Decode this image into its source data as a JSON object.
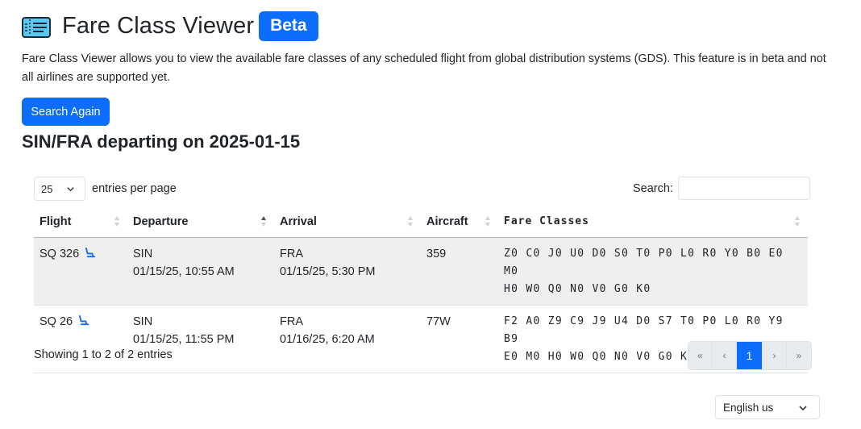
{
  "header": {
    "title": "Fare Class Viewer",
    "badge": "Beta",
    "description": "Fare Class Viewer allows you to view the available fare classes of any scheduled flight from global distribution systems (GDS). This feature is in beta and not all airlines are supported yet."
  },
  "search_again_label": "Search Again",
  "route_heading": "SIN/FRA departing on 2025-01-15",
  "controls": {
    "entries_value": "25",
    "entries_label": "entries per page",
    "search_label": "Search:",
    "search_value": ""
  },
  "table": {
    "columns": [
      "Flight",
      "Departure",
      "Arrival",
      "Aircraft",
      "Fare Classes"
    ],
    "rows": [
      {
        "flight": "SQ 326",
        "dep_airport": "SIN",
        "dep_time": "01/15/25, 10:55 AM",
        "arr_airport": "FRA",
        "arr_time": "01/15/25, 5:30 PM",
        "aircraft": "359",
        "fares_line1": "Z0 C0 J0 U0 D0 S0 T0 P0 L0 R0 Y0 B0 E0 M0",
        "fares_line2": "H0 W0 Q0 N0 V0 G0 K0"
      },
      {
        "flight": "SQ 26",
        "dep_airport": "SIN",
        "dep_time": "01/15/25, 11:55 PM",
        "arr_airport": "FRA",
        "arr_time": "01/16/25, 6:20 AM",
        "aircraft": "77W",
        "fares_line1": "F2 A0 Z9 C9 J9 U4 D0 S7 T0 P0 L0 R0 Y9 B9",
        "fares_line2": "E0 M0 H0 W0 Q0 N0 V0 G0 K0"
      }
    ]
  },
  "footer_info": "Showing 1 to 2 of 2 entries",
  "pagination": [
    "«",
    "‹",
    "1",
    "›",
    "»"
  ],
  "language": "English us",
  "colors": {
    "accent": "#0d6efd",
    "striped_row": "#efefef"
  },
  "icons": {
    "app": "ticket-icon",
    "flight_row": "seat-icon",
    "sort": "sort-icon"
  }
}
